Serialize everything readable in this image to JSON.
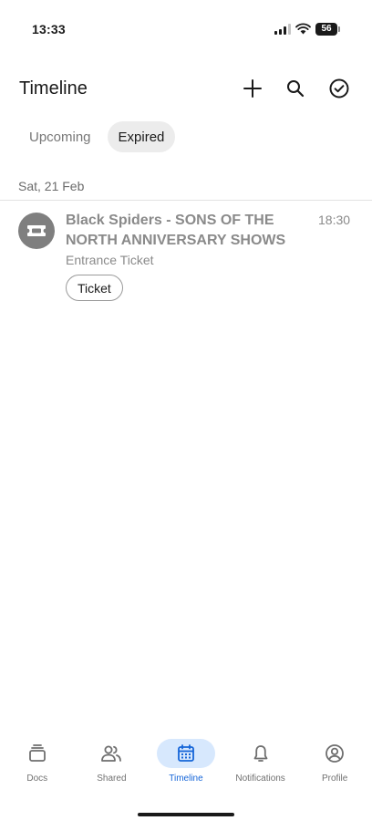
{
  "status_bar": {
    "time": "13:33",
    "battery": "56",
    "icons": [
      "signal-icon",
      "wifi-icon",
      "battery-icon"
    ]
  },
  "header": {
    "title": "Timeline",
    "actions": [
      "plus-icon",
      "search-icon",
      "check-circle-icon"
    ]
  },
  "tabs": [
    {
      "label": "Upcoming",
      "active": false
    },
    {
      "label": "Expired",
      "active": true
    }
  ],
  "timeline": {
    "date": "Sat, 21 Feb",
    "event": {
      "title": "Black Spiders - SONS OF THE NORTH ANNIVERSARY SHOWS",
      "time": "18:30",
      "subtitle": "Entrance Ticket",
      "chip": "Ticket",
      "icon": "ticket-icon"
    }
  },
  "bottom_nav": {
    "items": [
      {
        "label": "Docs",
        "icon": "docs-stack-icon",
        "active": false
      },
      {
        "label": "Shared",
        "icon": "people-icon",
        "active": false
      },
      {
        "label": "Timeline",
        "icon": "calendar-icon",
        "active": true
      },
      {
        "label": "Notifications",
        "icon": "bell-icon",
        "active": false
      },
      {
        "label": "Profile",
        "icon": "profile-icon",
        "active": false
      }
    ]
  },
  "colors": {
    "accent": "#1565d8",
    "accent_bg": "#d7e8fd",
    "muted_text": "#8a8a8a",
    "tab_active_bg": "#ececec"
  }
}
